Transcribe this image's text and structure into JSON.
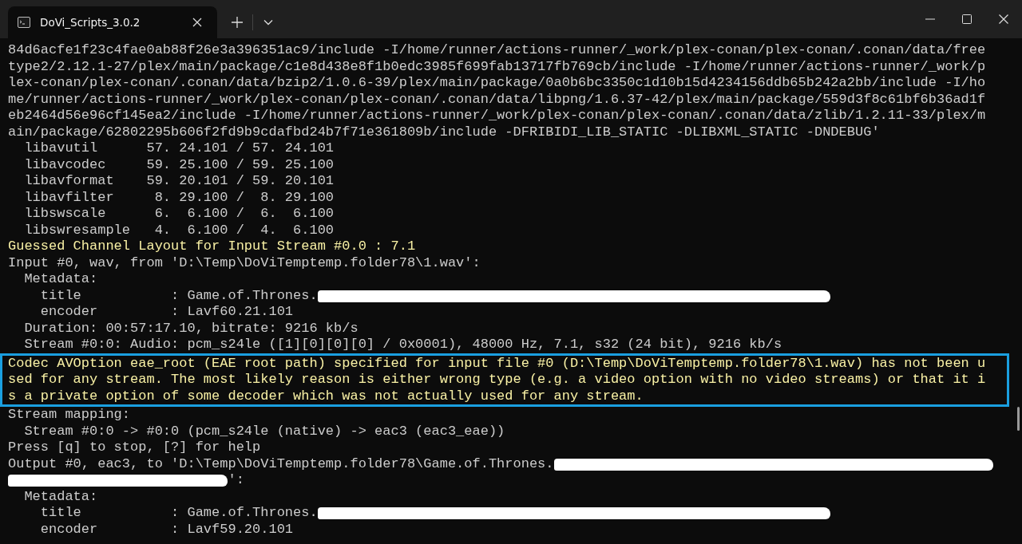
{
  "window": {
    "tab_title": "DoVi_Scripts_3.0.2"
  },
  "terminal": {
    "lines": [
      {
        "kind": "normal",
        "highlighted": false,
        "text": "84d6acfe1f23c4fae0ab88f26e3a396351ac9/include -I/home/runner/actions-runner/_work/plex-conan/plex-conan/.conan/data/free"
      },
      {
        "kind": "normal",
        "highlighted": false,
        "text": "type2/2.12.1-27/plex/main/package/c1e8d438e8f1b0edc3985f699fab13717fb769cb/include -I/home/runner/actions-runner/_work/p"
      },
      {
        "kind": "normal",
        "highlighted": false,
        "text": "lex-conan/plex-conan/.conan/data/bzip2/1.0.6-39/plex/main/package/0a0b6bc3350c1d10b15d4234156ddb65b242a2bb/include -I/ho"
      },
      {
        "kind": "normal",
        "highlighted": false,
        "text": "me/runner/actions-runner/_work/plex-conan/plex-conan/.conan/data/libpng/1.6.37-42/plex/main/package/559d3f8c61bf6b36ad1f"
      },
      {
        "kind": "normal",
        "highlighted": false,
        "text": "eb2464d56e96cf145ea2/include -I/home/runner/actions-runner/_work/plex-conan/plex-conan/.conan/data/zlib/1.2.11-33/plex/m"
      },
      {
        "kind": "normal",
        "highlighted": false,
        "text": "ain/package/62802295b606f2fd9b9cdafbd24b7f71e361809b/include -DFRIBIDI_LIB_STATIC -DLIBXML_STATIC -DNDEBUG'"
      },
      {
        "kind": "normal",
        "highlighted": false,
        "text": "  libavutil      57. 24.101 / 57. 24.101"
      },
      {
        "kind": "normal",
        "highlighted": false,
        "text": "  libavcodec     59. 25.100 / 59. 25.100"
      },
      {
        "kind": "normal",
        "highlighted": false,
        "text": "  libavformat    59. 20.101 / 59. 20.101"
      },
      {
        "kind": "normal",
        "highlighted": false,
        "text": "  libavfilter     8. 29.100 /  8. 29.100"
      },
      {
        "kind": "normal",
        "highlighted": false,
        "text": "  libswscale      6.  6.100 /  6.  6.100"
      },
      {
        "kind": "normal",
        "highlighted": false,
        "text": "  libswresample   4.  6.100 /  4.  6.100"
      },
      {
        "kind": "warning",
        "highlighted": false,
        "text": "Guessed Channel Layout for Input Stream #0.0 : 7.1"
      },
      {
        "kind": "normal",
        "highlighted": false,
        "text": "Input #0, wav, from 'D:\\Temp\\DoViTemptemp.folder78\\1.wav':"
      },
      {
        "kind": "normal",
        "highlighted": false,
        "text": "  Metadata:"
      },
      {
        "kind": "normal",
        "highlighted": false,
        "text": "    title           : Game.of.Thrones.",
        "redacted": true
      },
      {
        "kind": "normal",
        "highlighted": false,
        "text": "    encoder         : Lavf60.21.101"
      },
      {
        "kind": "normal",
        "highlighted": false,
        "text": "  Duration: 00:57:17.10, bitrate: 9216 kb/s"
      },
      {
        "kind": "normal",
        "highlighted": false,
        "text": "  Stream #0:0: Audio: pcm_s24le ([1][0][0][0] / 0x0001), 48000 Hz, 7.1, s32 (24 bit), 9216 kb/s"
      },
      {
        "kind": "warning",
        "highlighted": true,
        "text": "Codec AVOption eae_root (EAE root path) specified for input file #0 (D:\\Temp\\DoViTemptemp.folder78\\1.wav) has not been u"
      },
      {
        "kind": "warning",
        "highlighted": true,
        "text": "sed for any stream. The most likely reason is either wrong type (e.g. a video option with no video streams) or that it i"
      },
      {
        "kind": "warning",
        "highlighted": true,
        "text": "s a private option of some decoder which was not actually used for any stream."
      },
      {
        "kind": "normal",
        "highlighted": false,
        "text": "Stream mapping:"
      },
      {
        "kind": "normal",
        "highlighted": false,
        "text": "  Stream #0:0 -> #0:0 (pcm_s24le (native) -> eac3 (eac3_eae))"
      },
      {
        "kind": "normal",
        "highlighted": false,
        "text": "Press [q] to stop, [?] for help"
      },
      {
        "kind": "normal",
        "highlighted": false,
        "text": "Output #0, eac3, to 'D:\\Temp\\DoViTemptemp.folder78\\Game.of.Thrones.",
        "redacted": true
      },
      {
        "kind": "normal",
        "highlighted": false,
        "redacted": true,
        "suffix": "':"
      },
      {
        "kind": "normal",
        "highlighted": false,
        "text": "  Metadata:"
      },
      {
        "kind": "normal",
        "highlighted": false,
        "text": "    title           : Game.of.Thrones.",
        "redacted": true
      },
      {
        "kind": "normal",
        "highlighted": false,
        "text": "    encoder         : Lavf59.20.101"
      }
    ]
  }
}
